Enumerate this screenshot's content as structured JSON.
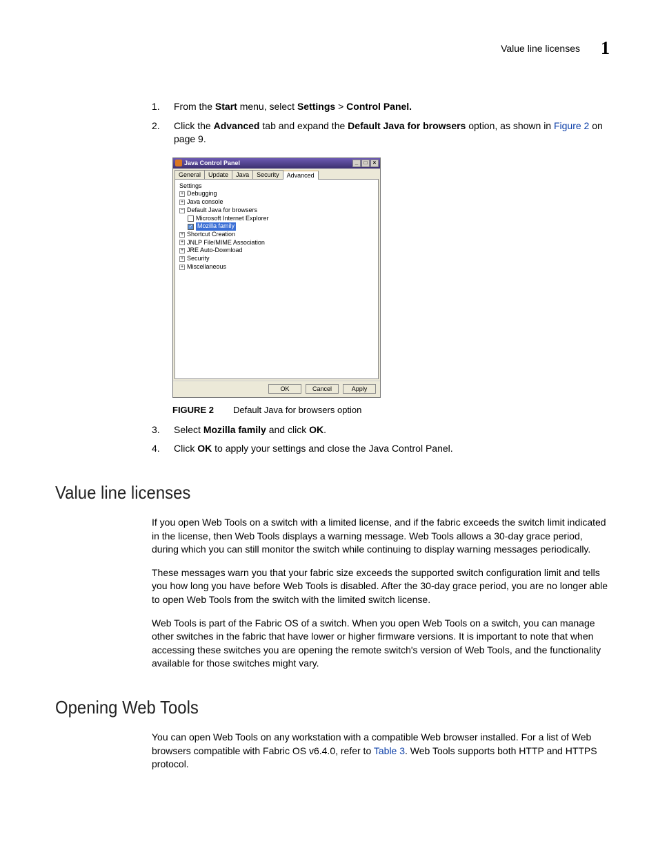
{
  "header": {
    "title": "Value line licenses",
    "chapter": "1"
  },
  "steps_a": {
    "s1": {
      "num": "1.",
      "pre": "From the ",
      "b1": "Start",
      "mid1": " menu, select ",
      "b2": "Settings",
      "mid2": " > ",
      "b3": "Control Panel."
    },
    "s2": {
      "num": "2.",
      "pre": "Click the ",
      "b1": "Advanced",
      "mid1": " tab and expand the ",
      "b2": "Default Java for browsers",
      "mid2": " option, as shown in ",
      "link": "Figure 2",
      "post": " on page 9."
    }
  },
  "java_panel": {
    "title": "Java Control Panel",
    "tabs": {
      "general": "General",
      "update": "Update",
      "java": "Java",
      "security": "Security",
      "advanced": "Advanced"
    },
    "tree": {
      "settings": "Settings",
      "debugging": "Debugging",
      "java_console": "Java console",
      "default_java": "Default Java for browsers",
      "msie": "Microsoft Internet Explorer",
      "mozilla": "Mozilla family",
      "shortcut": "Shortcut Creation",
      "jnlp": "JNLP File/MIME Association",
      "jre": "JRE Auto-Download",
      "security": "Security",
      "misc": "Miscellaneous"
    },
    "buttons": {
      "ok": "OK",
      "cancel": "Cancel",
      "apply": "Apply"
    }
  },
  "figure": {
    "label": "FIGURE 2",
    "caption": "Default Java for browsers option"
  },
  "steps_b": {
    "s3": {
      "num": "3.",
      "pre": "Select ",
      "b1": "Mozilla family",
      "mid": " and click ",
      "b2": "OK",
      "post": "."
    },
    "s4": {
      "num": "4.",
      "pre": "Click ",
      "b1": "OK",
      "post": " to apply your settings and close the Java Control Panel."
    }
  },
  "sections": {
    "value_line": {
      "heading": "Value line licenses",
      "p1": "If you open Web Tools on a switch with a limited license, and if the fabric exceeds the switch limit indicated in the license, then Web Tools displays a warning message. Web Tools allows a 30-day grace period, during which you can still monitor the switch while continuing to display warning messages periodically.",
      "p2": "These messages warn you that your fabric size exceeds the supported switch configuration limit and tells you how long you have before Web Tools is disabled. After the 30-day grace period, you are no longer able to open Web Tools from the switch with the limited switch license.",
      "p3": "Web Tools is part of the Fabric OS of a switch. When you open Web Tools on a switch, you can manage other switches in the fabric that have lower or higher firmware versions. It is important to note that when accessing these switches you are opening the remote switch's version of Web Tools, and the functionality available for those switches might vary."
    },
    "opening": {
      "heading": "Opening Web Tools",
      "p1_pre": "You can open Web Tools on any workstation with a compatible Web browser installed. For a list of Web browsers compatible with Fabric OS v6.4.0, refer to ",
      "p1_link": "Table 3",
      "p1_post": ". Web Tools supports both HTTP and HTTPS protocol."
    }
  }
}
